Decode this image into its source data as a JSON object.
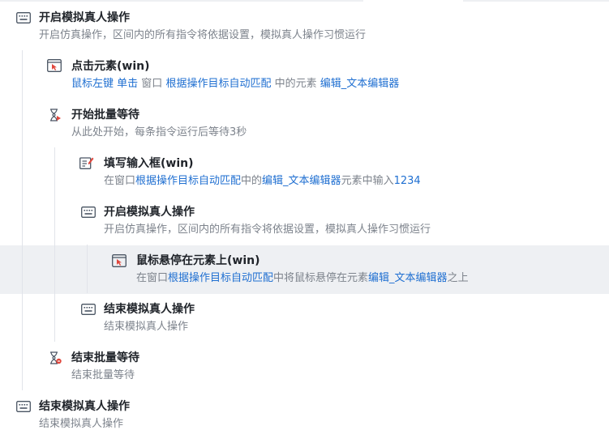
{
  "steps": [
    {
      "title": "开启模拟真人操作",
      "desc": [
        "开启仿真操作，区间内的所有指令将依据设置，模拟真人操作习惯运行"
      ],
      "icon": "keyboard-icon"
    },
    {
      "title": "点击元素(win)",
      "desc_parts": [
        {
          "t": "鼠标左键",
          "link": true
        },
        {
          "t": " ",
          "link": false
        },
        {
          "t": "单击",
          "link": true
        },
        {
          "t": " 窗口 ",
          "link": false
        },
        {
          "t": "根据操作目标自动匹配",
          "link": true
        },
        {
          "t": " 中的元素 ",
          "link": false
        },
        {
          "t": "编辑_文本编辑器",
          "link": true
        }
      ],
      "icon": "click-element-icon"
    },
    {
      "title": "开始批量等待",
      "desc": [
        "从此处开始，每条指令运行后等待3秒"
      ],
      "icon": "hourglass-start-icon"
    },
    {
      "title": "填写输入框(win)",
      "desc_parts": [
        {
          "t": "在窗口",
          "link": false
        },
        {
          "t": "根据操作目标自动匹配",
          "link": true
        },
        {
          "t": "中的",
          "link": false
        },
        {
          "t": "编辑_文本编辑器",
          "link": true
        },
        {
          "t": "元素中输入",
          "link": false
        },
        {
          "t": "1234",
          "link": true
        }
      ],
      "icon": "edit-input-icon"
    },
    {
      "title": "开启模拟真人操作",
      "desc": [
        "开启仿真操作，区间内的所有指令将依据设置，模拟真人操作习惯运行"
      ],
      "icon": "keyboard-icon"
    },
    {
      "title": "鼠标悬停在元素上(win)",
      "desc_parts": [
        {
          "t": "在窗口",
          "link": false
        },
        {
          "t": "根据操作目标自动匹配",
          "link": true
        },
        {
          "t": "中将鼠标悬停在元素",
          "link": false
        },
        {
          "t": "编辑_文本编辑器",
          "link": true
        },
        {
          "t": "之上",
          "link": false
        }
      ],
      "icon": "mouse-hover-icon"
    },
    {
      "title": "结束模拟真人操作",
      "desc": [
        "结束模拟真人操作"
      ],
      "icon": "keyboard-icon"
    },
    {
      "title": "结束批量等待",
      "desc": [
        "结束批量等待"
      ],
      "icon": "hourglass-end-icon"
    },
    {
      "title": "结束模拟真人操作",
      "desc": [
        "结束模拟真人操作"
      ],
      "icon": "keyboard-icon"
    }
  ],
  "colors": {
    "link": "#1f6fd1",
    "title": "#1f2329",
    "desc": "#7d838c",
    "highlight": "#eef0f3",
    "accent_red": "#e0463c"
  }
}
